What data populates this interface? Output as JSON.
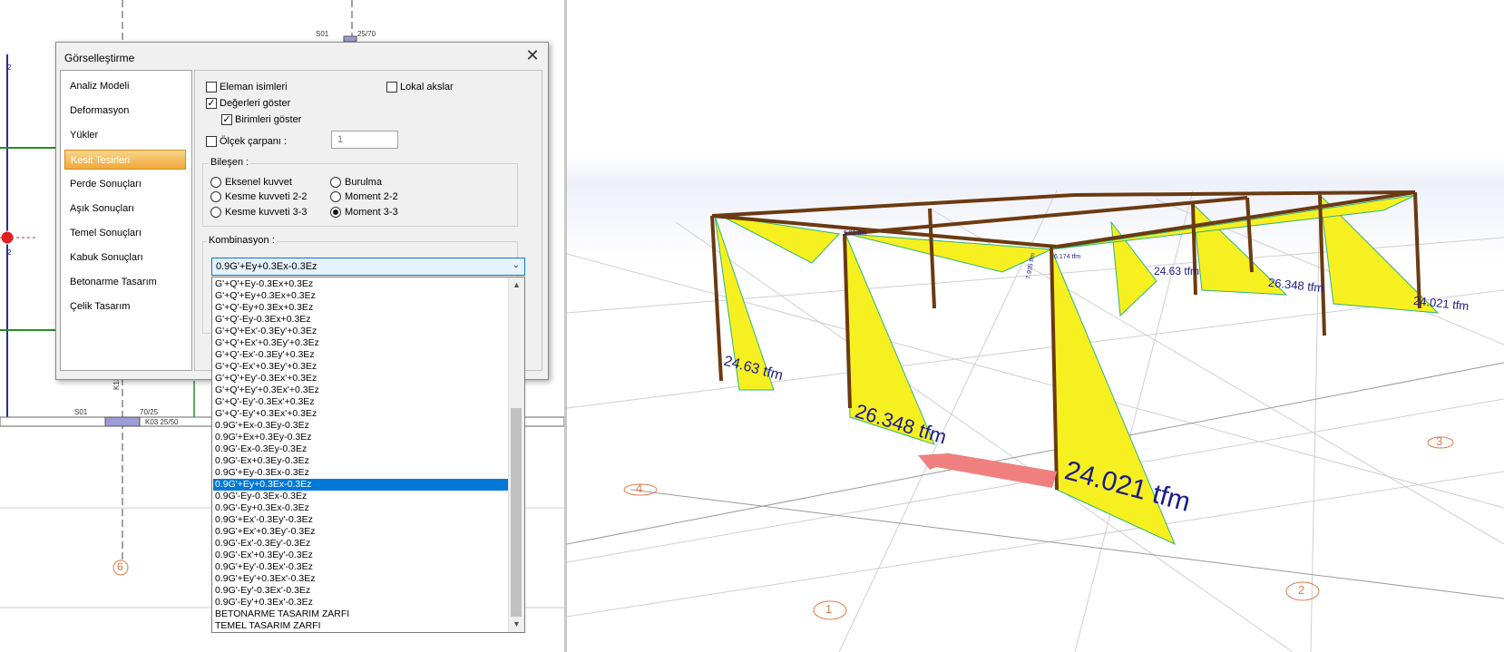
{
  "plan": {
    "labels": {
      "s01_top": "S01",
      "beam_top": "25/70",
      "s01_bottom": "S01",
      "beam_bottom_a": "70/25",
      "beam_bottom_b": "K03 25/50",
      "column": "K13 25/",
      "num_a": "2",
      "num_b": "2",
      "axis_6": "6"
    }
  },
  "dialog": {
    "title": "Görselleştirme",
    "nav": [
      "Analiz Modeli",
      "Deformasyon",
      "Yükler",
      "Kesit Tesirleri",
      "Perde Sonuçları",
      "Aşık Sonuçları",
      "Temel Sonuçları",
      "Kabuk Sonuçları",
      "Betonarme Tasarım",
      "Çelik Tasarım"
    ],
    "nav_selected": 3,
    "opts": {
      "eleman": "Eleman isimleri",
      "lokal": "Lokal akslar",
      "degerleri": "Değerleri göster",
      "birimleri": "Birimleri göster",
      "olcek": "Ölçek çarpanı :",
      "olcek_value": "1",
      "check_mark": "✓"
    },
    "bilesen": {
      "title": "Bileşen :",
      "items": [
        "Eksenel kuvvet",
        "Kesme kuvveti 2-2",
        "Kesme kuvveti 3-3",
        "Burulma",
        "Moment 2-2",
        "Moment 3-3"
      ],
      "selected": 5
    },
    "kombinasyon": {
      "title": "Kombinasyon :",
      "value": "0.9G'+Ey+0.3Ex-0.3Ez",
      "arrow": "⌄",
      "options": [
        "G'+Q'+Ey-0.3Ex+0.3Ez",
        "G'+Q'+Ey+0.3Ex+0.3Ez",
        "G'+Q'-Ey+0.3Ex+0.3Ez",
        "G'+Q'-Ey-0.3Ex+0.3Ez",
        "G'+Q'+Ex'-0.3Ey'+0.3Ez",
        "G'+Q'+Ex'+0.3Ey'+0.3Ez",
        "G'+Q'-Ex'-0.3Ey'+0.3Ez",
        "G'+Q'-Ex'+0.3Ey'+0.3Ez",
        "G'+Q'+Ey'-0.3Ex'+0.3Ez",
        "G'+Q'+Ey'+0.3Ex'+0.3Ez",
        "G'+Q'-Ey'-0.3Ex'+0.3Ez",
        "G'+Q'-Ey'+0.3Ex'+0.3Ez",
        "0.9G'+Ex-0.3Ey-0.3Ez",
        "0.9G'+Ex+0.3Ey-0.3Ez",
        "0.9G'-Ex-0.3Ey-0.3Ez",
        "0.9G'-Ex+0.3Ey-0.3Ez",
        "0.9G'+Ey-0.3Ex-0.3Ez",
        "0.9G'+Ey+0.3Ex-0.3Ez",
        "0.9G'-Ey-0.3Ex-0.3Ez",
        "0.9G'-Ey+0.3Ex-0.3Ez",
        "0.9G'+Ex'-0.3Ey'-0.3Ez",
        "0.9G'+Ex'+0.3Ey'-0.3Ez",
        "0.9G'-Ex'-0.3Ey'-0.3Ez",
        "0.9G'-Ex'+0.3Ey'-0.3Ez",
        "0.9G'+Ey'-0.3Ex'-0.3Ez",
        "0.9G'+Ey'+0.3Ex'-0.3Ez",
        "0.9G'-Ey'-0.3Ex'-0.3Ez",
        "0.9G'-Ey'+0.3Ex'-0.3Ez",
        "BETONARME TASARIM ZARFI",
        "TEMEL TASARIM ZARFI"
      ],
      "selected_index": 17
    }
  },
  "model3d": {
    "labels": {
      "big_front": "24.021 tfm",
      "mid_front": "26.348 tfm",
      "left_front": "24.63 tfm",
      "back_a": "24.63 tfm",
      "back_b": "26.348 tfm",
      "back_c": "24.021 tfm",
      "small_a": "6.174 tfm",
      "small_b": "7.935 tfm",
      "small_c": "5.81 tfm"
    },
    "axes": [
      "1",
      "2",
      "3",
      "4"
    ]
  },
  "colors": {
    "yellow": "#f7f020",
    "frame": "#6b3a10",
    "arrow": "#f08080",
    "grid": "#c8c8c8",
    "select": "#0078d7"
  }
}
